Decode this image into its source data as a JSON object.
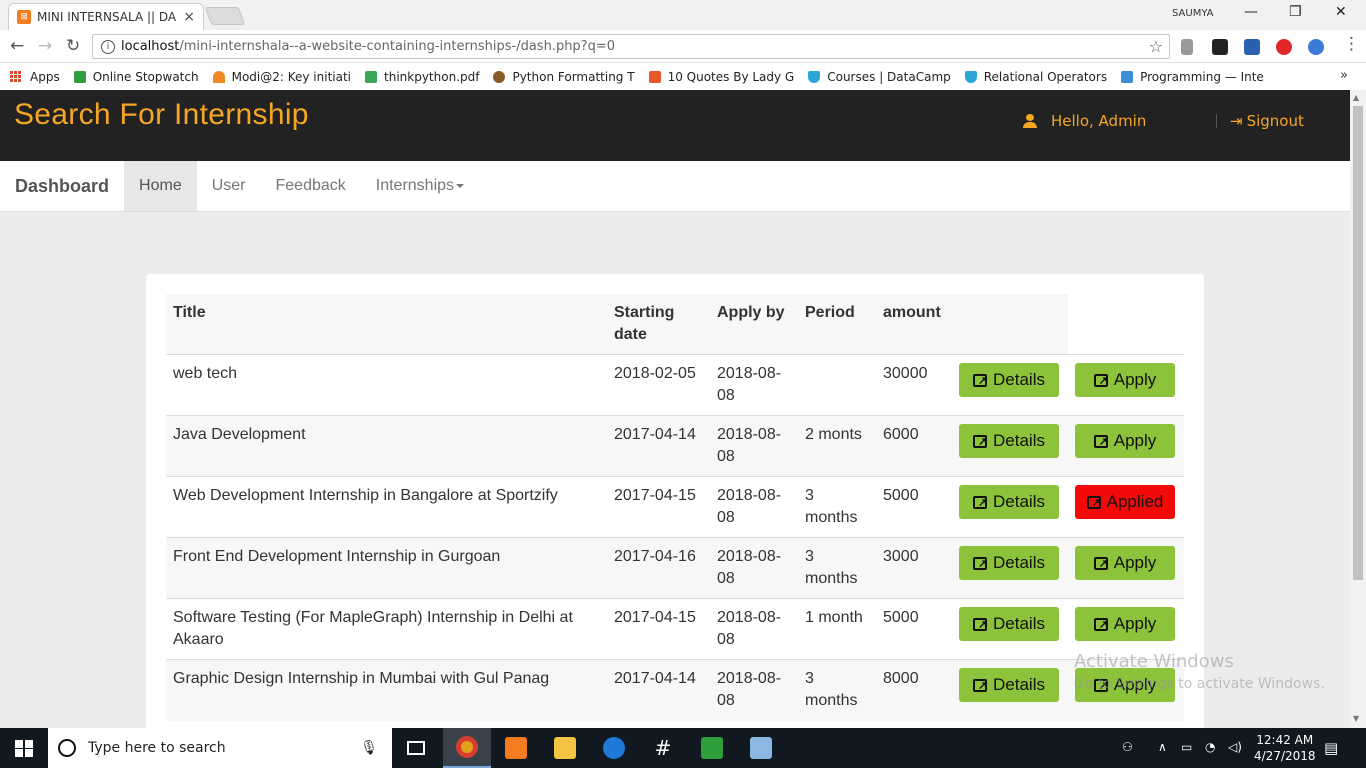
{
  "browser": {
    "tab_title": "MINI INTERNSALA || DAS",
    "user": "SAUMYA",
    "url_host": "localhost",
    "url_path": "/mini-internshala--a-website-containing-internships-/dash.php?q=0"
  },
  "bookmarks": [
    {
      "label": "Apps",
      "icon": "apps-grid-icon",
      "color": "#d84e2b"
    },
    {
      "label": "Online Stopwatch",
      "icon": "stopwatch-icon",
      "color": "#2e9e3e"
    },
    {
      "label": "Modi@2: Key initiati",
      "icon": "rainbow-icon",
      "color": "#f08a24"
    },
    {
      "label": "thinkpython.pdf",
      "icon": "leaf-icon",
      "color": "#3aa655"
    },
    {
      "label": "Python Formatting T",
      "icon": "python-icon",
      "color": "#8a5a2b"
    },
    {
      "label": "10 Quotes By Lady G",
      "icon": "s-icon",
      "color": "#e45a2b"
    },
    {
      "label": "Courses | DataCamp",
      "icon": "shield-icon",
      "color": "#2aa6d6"
    },
    {
      "label": "Relational Operators",
      "icon": "shield-icon",
      "color": "#2aa6d6"
    },
    {
      "label": "Programming — Inte",
      "icon": "ib-icon",
      "color": "#3b8fd6"
    }
  ],
  "site": {
    "brand": "Search For Internship",
    "greeting": "Hello,  Admin",
    "signout": "Signout"
  },
  "menu": {
    "brand": "Dashboard",
    "items": [
      {
        "label": "Home",
        "active": true
      },
      {
        "label": "User",
        "active": false
      },
      {
        "label": "Feedback",
        "active": false
      },
      {
        "label": "Internships",
        "active": false,
        "dropdown": true
      }
    ]
  },
  "table": {
    "headers": [
      "Title",
      "Starting date",
      "Apply by",
      "Period",
      "amount"
    ],
    "details_label": "Details",
    "rows": [
      {
        "title": "web tech",
        "start": "2018-02-05",
        "apply_by": "2018-08-08",
        "period": "",
        "amount": "30000",
        "action": "Apply",
        "applied": false
      },
      {
        "title": "Java Development",
        "start": "2017-04-14",
        "apply_by": "2018-08-08",
        "period": "2 monts",
        "amount": "6000",
        "action": "Apply",
        "applied": false
      },
      {
        "title": "Web Development Internship in Bangalore at Sportzify",
        "start": "2017-04-15",
        "apply_by": "2018-08-08",
        "period": "3 months",
        "amount": "5000",
        "action": "Applied",
        "applied": true
      },
      {
        "title": "Front End Development Internship in Gurgoan",
        "start": "2017-04-16",
        "apply_by": "2018-08-08",
        "period": "3 months",
        "amount": "3000",
        "action": "Apply",
        "applied": false
      },
      {
        "title": "Software Testing (For MapleGraph) Internship in Delhi at Akaaro",
        "start": "2017-04-15",
        "apply_by": "2018-08-08",
        "period": "1 month",
        "amount": "5000",
        "action": "Apply",
        "applied": false
      },
      {
        "title": "Graphic Design Internship in Mumbai with Gul Panag",
        "start": "2017-04-14",
        "apply_by": "2018-08-08",
        "period": "3 months",
        "amount": "8000",
        "action": "Apply",
        "applied": false
      }
    ]
  },
  "watermark": {
    "line1": "Activate Windows",
    "line2": "Go to Settings to activate Windows."
  },
  "taskbar": {
    "search_placeholder": "Type here to search",
    "time": "12:42 AM",
    "date": "4/27/2018"
  },
  "colors": {
    "accent": "#f5a623",
    "header_bg": "#222222",
    "button_green": "#8cc33a",
    "button_red": "#f20a0a"
  }
}
